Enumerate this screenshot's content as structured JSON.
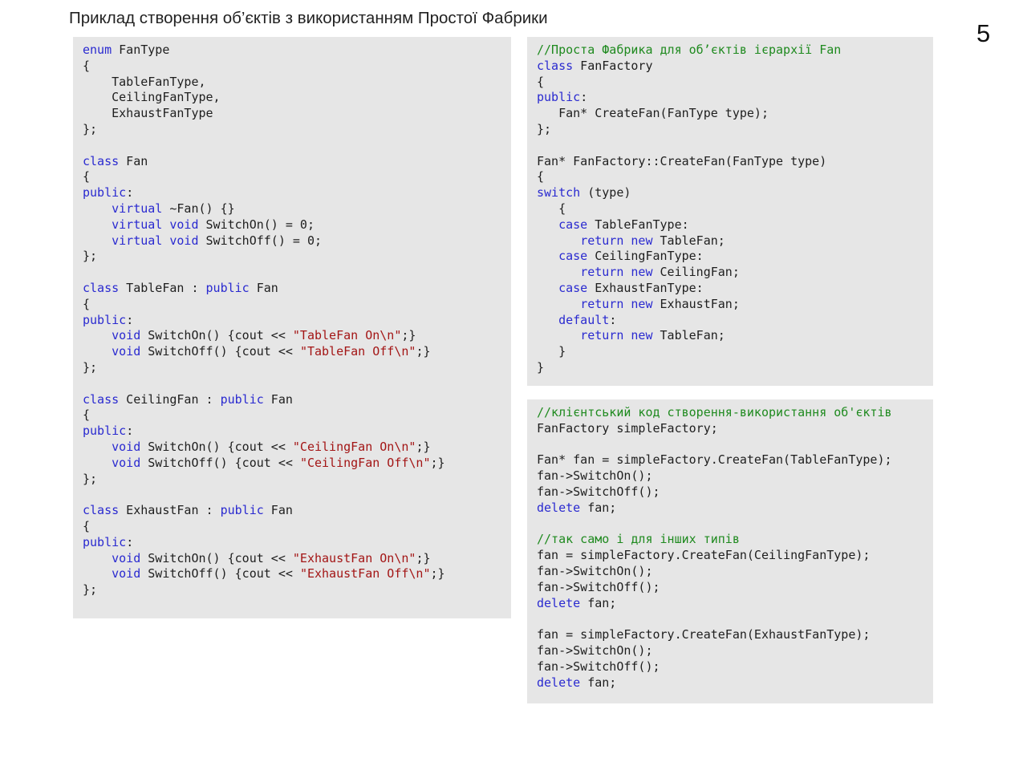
{
  "slide": {
    "title": "Приклад створення об’єктів з використанням Простої Фабрики",
    "page_number": "5"
  },
  "colors": {
    "keyword": "#2a2ad0",
    "string": "#a31515",
    "comment": "#1f8a1f",
    "text": "#1e1e1e",
    "panel": "#e6e6e6"
  },
  "panels": {
    "left": [
      [
        [
          "k",
          "enum"
        ],
        [
          "p",
          " FanType"
        ]
      ],
      [
        [
          "p",
          "{"
        ]
      ],
      [
        [
          "p",
          "    TableFanType,"
        ]
      ],
      [
        [
          "p",
          "    CeilingFanType,"
        ]
      ],
      [
        [
          "p",
          "    ExhaustFanType"
        ]
      ],
      [
        [
          "p",
          "};"
        ]
      ],
      [],
      [
        [
          "k",
          "class"
        ],
        [
          "p",
          " Fan"
        ]
      ],
      [
        [
          "p",
          "{"
        ]
      ],
      [
        [
          "k",
          "public"
        ],
        [
          "p",
          ":"
        ]
      ],
      [
        [
          "p",
          "    "
        ],
        [
          "k",
          "virtual"
        ],
        [
          "p",
          " ~Fan() {}"
        ]
      ],
      [
        [
          "p",
          "    "
        ],
        [
          "k",
          "virtual"
        ],
        [
          "p",
          " "
        ],
        [
          "k",
          "void"
        ],
        [
          "p",
          " SwitchOn() = 0;"
        ]
      ],
      [
        [
          "p",
          "    "
        ],
        [
          "k",
          "virtual"
        ],
        [
          "p",
          " "
        ],
        [
          "k",
          "void"
        ],
        [
          "p",
          " SwitchOff() = 0;"
        ]
      ],
      [
        [
          "p",
          "};"
        ]
      ],
      [],
      [
        [
          "k",
          "class"
        ],
        [
          "p",
          " TableFan : "
        ],
        [
          "k",
          "public"
        ],
        [
          "p",
          " Fan"
        ]
      ],
      [
        [
          "p",
          "{"
        ]
      ],
      [
        [
          "k",
          "public"
        ],
        [
          "p",
          ":"
        ]
      ],
      [
        [
          "p",
          "    "
        ],
        [
          "k",
          "void"
        ],
        [
          "p",
          " SwitchOn() {cout << "
        ],
        [
          "s",
          "\"TableFan On\\n\""
        ],
        [
          "p",
          ";}"
        ]
      ],
      [
        [
          "p",
          "    "
        ],
        [
          "k",
          "void"
        ],
        [
          "p",
          " SwitchOff() {cout << "
        ],
        [
          "s",
          "\"TableFan Off\\n\""
        ],
        [
          "p",
          ";}"
        ]
      ],
      [
        [
          "p",
          "};"
        ]
      ],
      [],
      [
        [
          "k",
          "class"
        ],
        [
          "p",
          " CeilingFan : "
        ],
        [
          "k",
          "public"
        ],
        [
          "p",
          " Fan"
        ]
      ],
      [
        [
          "p",
          "{"
        ]
      ],
      [
        [
          "k",
          "public"
        ],
        [
          "p",
          ":"
        ]
      ],
      [
        [
          "p",
          "    "
        ],
        [
          "k",
          "void"
        ],
        [
          "p",
          " SwitchOn() {cout << "
        ],
        [
          "s",
          "\"CeilingFan On\\n\""
        ],
        [
          "p",
          ";}"
        ]
      ],
      [
        [
          "p",
          "    "
        ],
        [
          "k",
          "void"
        ],
        [
          "p",
          " SwitchOff() {cout << "
        ],
        [
          "s",
          "\"CeilingFan Off\\n\""
        ],
        [
          "p",
          ";}"
        ]
      ],
      [
        [
          "p",
          "};"
        ]
      ],
      [],
      [
        [
          "k",
          "class"
        ],
        [
          "p",
          " ExhaustFan : "
        ],
        [
          "k",
          "public"
        ],
        [
          "p",
          " Fan"
        ]
      ],
      [
        [
          "p",
          "{"
        ]
      ],
      [
        [
          "k",
          "public"
        ],
        [
          "p",
          ":"
        ]
      ],
      [
        [
          "p",
          "    "
        ],
        [
          "k",
          "void"
        ],
        [
          "p",
          " SwitchOn() {cout << "
        ],
        [
          "s",
          "\"ExhaustFan On\\n\""
        ],
        [
          "p",
          ";}"
        ]
      ],
      [
        [
          "p",
          "    "
        ],
        [
          "k",
          "void"
        ],
        [
          "p",
          " SwitchOff() {cout << "
        ],
        [
          "s",
          "\"ExhaustFan Off\\n\""
        ],
        [
          "p",
          ";}"
        ]
      ],
      [
        [
          "p",
          "};"
        ]
      ]
    ],
    "right_top": [
      [
        [
          "c",
          "//Проста Фабрика для об’єктів ієрархії Fan"
        ]
      ],
      [
        [
          "k",
          "class"
        ],
        [
          "p",
          " FanFactory"
        ]
      ],
      [
        [
          "p",
          "{"
        ]
      ],
      [
        [
          "k",
          "public"
        ],
        [
          "p",
          ":"
        ]
      ],
      [
        [
          "p",
          "   Fan* CreateFan(FanType type);"
        ]
      ],
      [
        [
          "p",
          "};"
        ]
      ],
      [],
      [
        [
          "p",
          "Fan* FanFactory::CreateFan(FanType type)"
        ]
      ],
      [
        [
          "p",
          "{"
        ]
      ],
      [
        [
          "k",
          "switch"
        ],
        [
          "p",
          " (type)"
        ]
      ],
      [
        [
          "p",
          "   {"
        ]
      ],
      [
        [
          "p",
          "   "
        ],
        [
          "k",
          "case"
        ],
        [
          "p",
          " TableFanType:"
        ]
      ],
      [
        [
          "p",
          "      "
        ],
        [
          "k",
          "return"
        ],
        [
          "p",
          " "
        ],
        [
          "k",
          "new"
        ],
        [
          "p",
          " TableFan;"
        ]
      ],
      [
        [
          "p",
          "   "
        ],
        [
          "k",
          "case"
        ],
        [
          "p",
          " CeilingFanType:"
        ]
      ],
      [
        [
          "p",
          "      "
        ],
        [
          "k",
          "return"
        ],
        [
          "p",
          " "
        ],
        [
          "k",
          "new"
        ],
        [
          "p",
          " CeilingFan;"
        ]
      ],
      [
        [
          "p",
          "   "
        ],
        [
          "k",
          "case"
        ],
        [
          "p",
          " ExhaustFanType:"
        ]
      ],
      [
        [
          "p",
          "      "
        ],
        [
          "k",
          "return"
        ],
        [
          "p",
          " "
        ],
        [
          "k",
          "new"
        ],
        [
          "p",
          " ExhaustFan;"
        ]
      ],
      [
        [
          "p",
          "   "
        ],
        [
          "k",
          "default"
        ],
        [
          "p",
          ":"
        ]
      ],
      [
        [
          "p",
          "      "
        ],
        [
          "k",
          "return"
        ],
        [
          "p",
          " "
        ],
        [
          "k",
          "new"
        ],
        [
          "p",
          " TableFan;"
        ]
      ],
      [
        [
          "p",
          "   }"
        ]
      ],
      [
        [
          "p",
          "}"
        ]
      ]
    ],
    "right_bottom": [
      [
        [
          "c",
          "//клієнтський код створення-використання об'єктів"
        ]
      ],
      [
        [
          "p",
          "FanFactory simpleFactory;"
        ]
      ],
      [],
      [
        [
          "p",
          "Fan* fan = simpleFactory.CreateFan(TableFanType);"
        ]
      ],
      [
        [
          "p",
          "fan->SwitchOn();"
        ]
      ],
      [
        [
          "p",
          "fan->SwitchOff();"
        ]
      ],
      [
        [
          "k",
          "delete"
        ],
        [
          "p",
          " fan;"
        ]
      ],
      [],
      [
        [
          "c",
          "//так само і для інших типів"
        ]
      ],
      [
        [
          "p",
          "fan = simpleFactory.CreateFan(CeilingFanType);"
        ]
      ],
      [
        [
          "p",
          "fan->SwitchOn();"
        ]
      ],
      [
        [
          "p",
          "fan->SwitchOff();"
        ]
      ],
      [
        [
          "k",
          "delete"
        ],
        [
          "p",
          " fan;"
        ]
      ],
      [],
      [
        [
          "p",
          "fan = simpleFactory.CreateFan(ExhaustFanType);"
        ]
      ],
      [
        [
          "p",
          "fan->SwitchOn();"
        ]
      ],
      [
        [
          "p",
          "fan->SwitchOff();"
        ]
      ],
      [
        [
          "k",
          "delete"
        ],
        [
          "p",
          " fan;"
        ]
      ]
    ]
  }
}
